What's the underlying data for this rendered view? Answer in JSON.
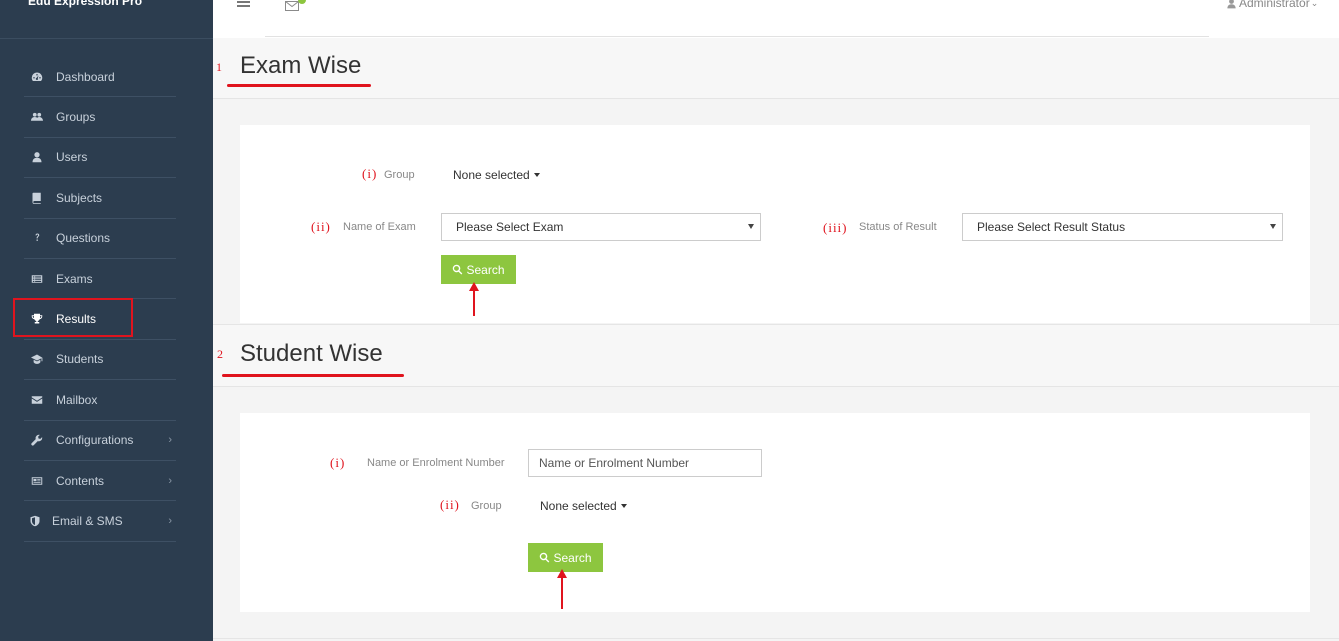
{
  "app": {
    "brand": "Edu Expression Pro"
  },
  "topbar": {
    "user": "Administrator"
  },
  "sidebar": {
    "items": [
      {
        "label": "Dashboard",
        "icon": "dashboard-icon"
      },
      {
        "label": "Groups",
        "icon": "users-group-icon"
      },
      {
        "label": "Users",
        "icon": "user-icon"
      },
      {
        "label": "Subjects",
        "icon": "book-icon"
      },
      {
        "label": "Questions",
        "icon": "question-icon"
      },
      {
        "label": "Exams",
        "icon": "list-icon"
      },
      {
        "label": "Results",
        "icon": "trophy-icon",
        "active": true
      },
      {
        "label": "Students",
        "icon": "graduation-cap-icon"
      },
      {
        "label": "Mailbox",
        "icon": "envelope-icon"
      },
      {
        "label": "Configurations",
        "icon": "wrench-icon",
        "chevron": "›"
      },
      {
        "label": "Contents",
        "icon": "newspaper-icon",
        "chevron": "›"
      },
      {
        "label": "Email & SMS",
        "icon": "shield-icon",
        "chevron": "›"
      }
    ]
  },
  "exam_wise": {
    "number": "1",
    "title": "Exam Wise",
    "group": {
      "roman": "(i)",
      "label": "Group",
      "value": "None selected"
    },
    "exam": {
      "roman": "(ii)",
      "label": "Name of Exam",
      "value": "Please Select Exam"
    },
    "status": {
      "roman": "(iii)",
      "label": "Status of Result",
      "value": "Please Select Result Status"
    },
    "search_label": "Search"
  },
  "student_wise": {
    "number": "2",
    "title": "Student Wise",
    "name": {
      "roman": "(i)",
      "label": "Name or Enrolment Number",
      "placeholder": "Name or Enrolment Number"
    },
    "group": {
      "roman": "(ii)",
      "label": "Group",
      "value": "None selected"
    },
    "search_label": "Search"
  },
  "colors": {
    "sidebar": "#2c3d4f",
    "accent": "#8dc63f",
    "annotation": "#e0141e"
  }
}
